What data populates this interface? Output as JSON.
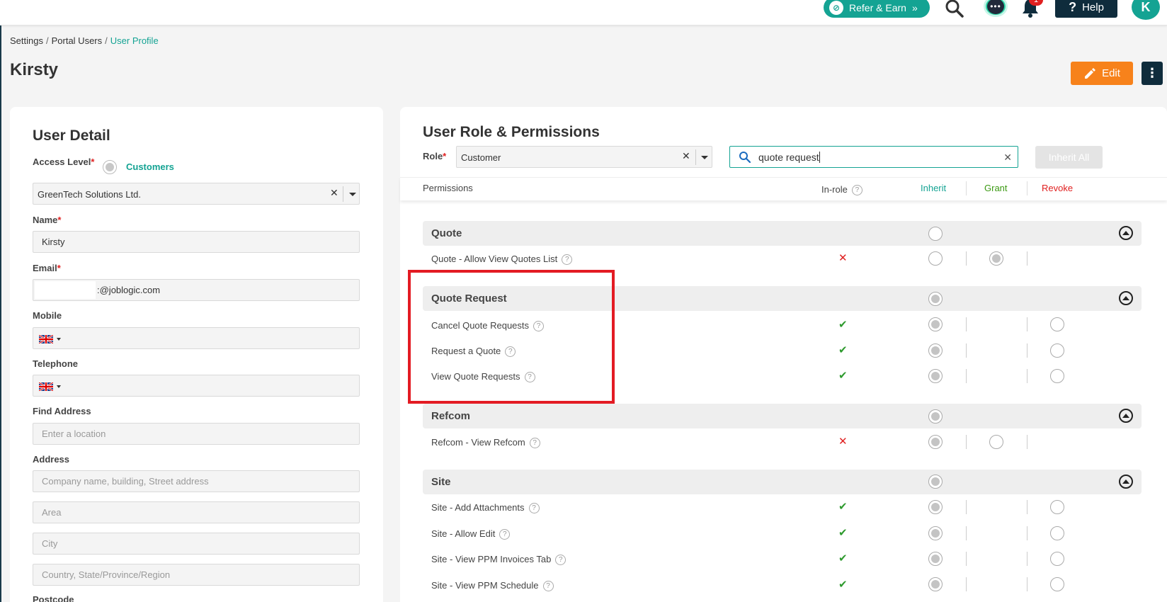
{
  "topbar": {
    "refer_label": "Refer & Earn",
    "refer_icon": "joblogic-logo-icon",
    "notification_count": "1",
    "help_label": "Help",
    "avatar_initial": "K"
  },
  "breadcrumb": {
    "items": [
      "Settings",
      "Portal Users",
      "User Profile"
    ]
  },
  "page": {
    "title": "Kirsty",
    "edit_label": "Edit"
  },
  "user_detail": {
    "title": "User Detail",
    "access_level_label": "Access Level",
    "access_level_value": "Customers",
    "customer_value": "GreenTech Solutions Ltd.",
    "name_label": "Name",
    "name_value": "Kirsty",
    "email_label": "Email",
    "email_value": ":@joblogic.com",
    "mobile_label": "Mobile",
    "telephone_label": "Telephone",
    "find_address_label": "Find Address",
    "find_address_placeholder": "Enter a location",
    "address_label": "Address",
    "address_placeholder": "Company name, building, Street address",
    "area_placeholder": "Area",
    "city_placeholder": "City",
    "country_placeholder": "Country, State/Province/Region",
    "postcode_label": "Postcode"
  },
  "permissions": {
    "title": "User Role & Permissions",
    "role_label": "Role",
    "role_value": "Customer",
    "search_value": "quote request",
    "inherit_all_label": "Inherit All",
    "headers": {
      "permissions": "Permissions",
      "in_role": "In-role",
      "inherit": "Inherit",
      "grant": "Grant",
      "revoke": "Revoke"
    },
    "colors": {
      "inherit": "#14a393",
      "grant": "#3c9a14",
      "revoke": "#e02020",
      "accent": "#14a393",
      "edit": "#f7821b"
    },
    "groups": [
      {
        "name": "Quote",
        "items": [
          {
            "name": "Quote - Allow View Quotes List",
            "in_role": "✕"
          }
        ]
      },
      {
        "name": "Quote Request",
        "items": [
          {
            "name": "Cancel Quote Requests",
            "in_role": "✔"
          },
          {
            "name": "Request a Quote",
            "in_role": "✔"
          },
          {
            "name": "View Quote Requests",
            "in_role": "✔"
          }
        ]
      },
      {
        "name": "Refcom",
        "items": [
          {
            "name": "Refcom - View Refcom",
            "in_role": "✕"
          }
        ]
      },
      {
        "name": "Site",
        "items": [
          {
            "name": "Site - Add Attachments",
            "in_role": "✔"
          },
          {
            "name": "Site - Allow Edit",
            "in_role": "✔"
          },
          {
            "name": "Site - View PPM Invoices Tab",
            "in_role": "✔"
          },
          {
            "name": "Site - View PPM Schedule",
            "in_role": "✔"
          }
        ]
      }
    ]
  }
}
